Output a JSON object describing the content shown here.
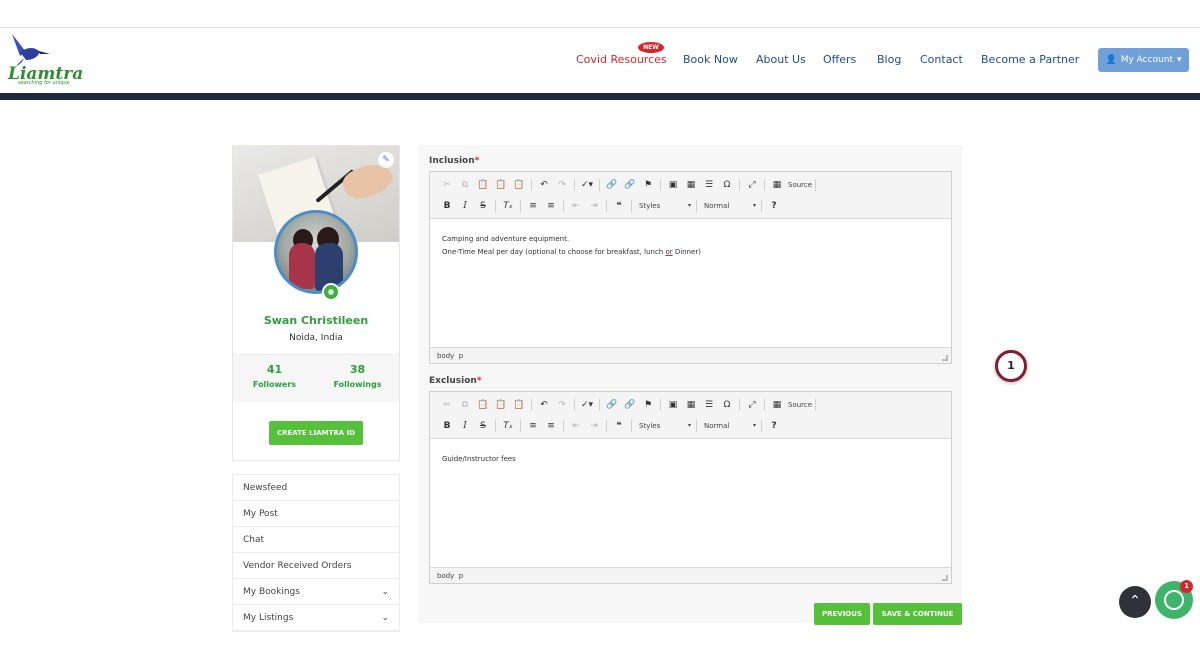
{
  "brand": {
    "logo_text": "Liamtra",
    "tagline": "searching for unique"
  },
  "nav": {
    "covid": "Covid Resources",
    "new_badge": "NEW",
    "book_now": "Book Now",
    "about_us": "About Us",
    "offers": "Offers",
    "blog": "Blog",
    "contact": "Contact",
    "become_partner": "Become a Partner",
    "my_account": "My Account"
  },
  "profile": {
    "name": "Swan Christileen",
    "location": "Noida, India",
    "followers_count": "41",
    "followers_label": "Followers",
    "followings_count": "38",
    "followings_label": "Followings",
    "create_button": "CREATE LIAMTRA ID"
  },
  "menu": {
    "items": [
      {
        "label": "Newsfeed"
      },
      {
        "label": "My Post"
      },
      {
        "label": "Chat"
      },
      {
        "label": "Vendor Received Orders"
      },
      {
        "label": "My Bookings"
      },
      {
        "label": "My Listings"
      }
    ]
  },
  "form": {
    "inclusion_label": "Inclusion",
    "exclusion_label": "Exclusion",
    "required_mark": "*",
    "inclusion_line1": "Camping and adventure equipment.",
    "inclusion_line2_a": "One-Time Meal per day (optional to choose for breakfast, lunch ",
    "inclusion_line2_or": "or",
    "inclusion_line2_b": " Dinner)",
    "exclusion_line1": "Guide/Instructor fees",
    "previous": "PREVIOUS",
    "save_continue": "SAVE & CONTINUE"
  },
  "editor": {
    "source": "Source",
    "styles": "Styles",
    "format": "Normal",
    "path_body": "body",
    "path_p": "p"
  },
  "floating": {
    "badge_count": "1",
    "chat_count": "1"
  },
  "colors": {
    "nav_link": "#1f4e8c",
    "covid": "#d7262b",
    "accent_green": "#55c13a",
    "header_bar": "#1e2a3c",
    "account_button": "#6fa0d8"
  }
}
